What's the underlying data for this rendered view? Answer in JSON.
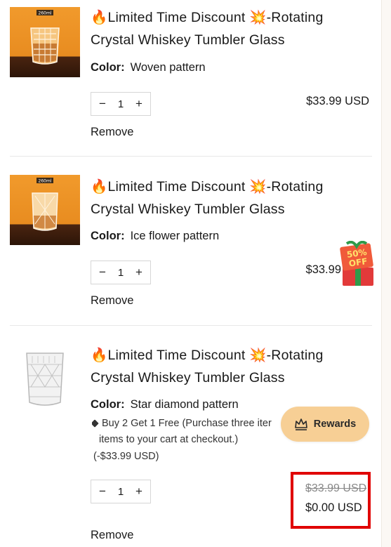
{
  "cart": {
    "items": [
      {
        "title_line1": "🔥Limited Time Discount 💥-Rotating",
        "title_line2": "Crystal Whiskey Tumbler Glass",
        "color_label": "Color:",
        "color_value": "Woven pattern",
        "quantity": "1",
        "price": "$33.99 USD",
        "remove_label": "Remove",
        "image_badge": "260ml"
      },
      {
        "title_line1": "🔥Limited Time Discount 💥-Rotating",
        "title_line2": "Crystal Whiskey Tumbler Glass",
        "color_label": "Color:",
        "color_value": "Ice flower pattern",
        "quantity": "1",
        "price": "$33.99",
        "remove_label": "Remove",
        "image_badge": "260ml"
      },
      {
        "title_line1": "🔥Limited Time Discount 💥-Rotating",
        "title_line2": "Crystal Whiskey Tumbler Glass",
        "color_label": "Color:",
        "color_value": "Star diamond pattern",
        "promo_line1": "Buy 2 Get 1 Free (Purchase three iter",
        "promo_line2": "items to your cart at checkout.)",
        "promo_amount": "(-$33.99 USD)",
        "quantity": "1",
        "original_price": "$33.99 USD",
        "price": "$0.00 USD",
        "remove_label": "Remove"
      }
    ]
  },
  "rewards": {
    "label": "Rewards",
    "icon": "crown-icon"
  },
  "sale_badge": {
    "line1": "50%",
    "line2": "OFF"
  },
  "qty_controls": {
    "minus": "−",
    "plus": "+"
  },
  "colors": {
    "rewards_bg": "#f7cf95",
    "highlight": "#e00000",
    "thumb_orange": "#f19a2c"
  }
}
